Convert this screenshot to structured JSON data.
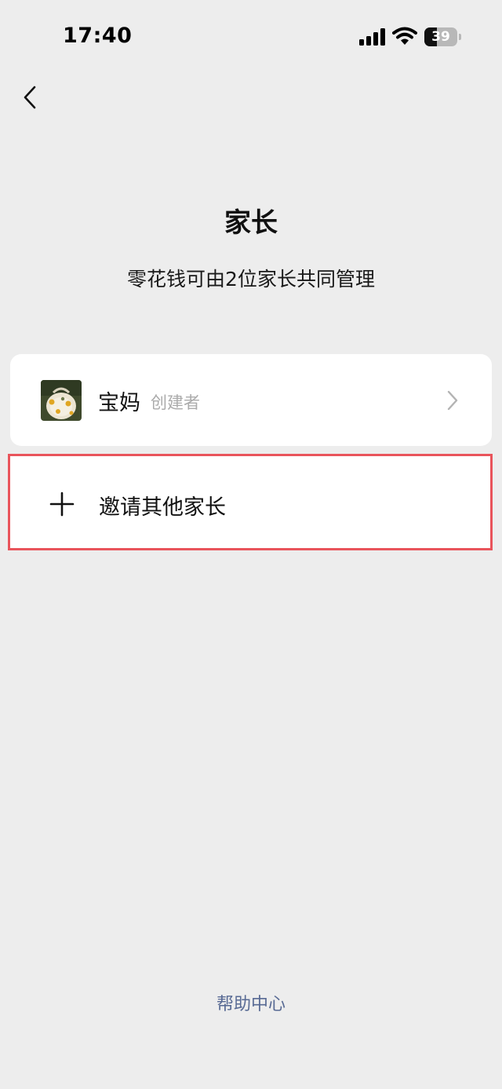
{
  "status_bar": {
    "time": "17:40",
    "battery_level": "39",
    "battery_fraction": 0.39,
    "icons": [
      "signal-icon",
      "wifi-icon",
      "battery-icon"
    ]
  },
  "nav": {
    "back_icon": "chevron-left-icon"
  },
  "header": {
    "title": "家长",
    "subtitle": "零花钱可由2位家长共同管理"
  },
  "parents": [
    {
      "name": "宝妈",
      "role": "创建者",
      "avatar_icon": "avatar-photo",
      "trailing_icon": "chevron-right-icon"
    }
  ],
  "invite": {
    "label": "邀请其他家长",
    "icon": "plus-icon",
    "highlight_color": "#e9545b"
  },
  "footer": {
    "help_label": "帮助中心",
    "link_color": "#586a94"
  }
}
